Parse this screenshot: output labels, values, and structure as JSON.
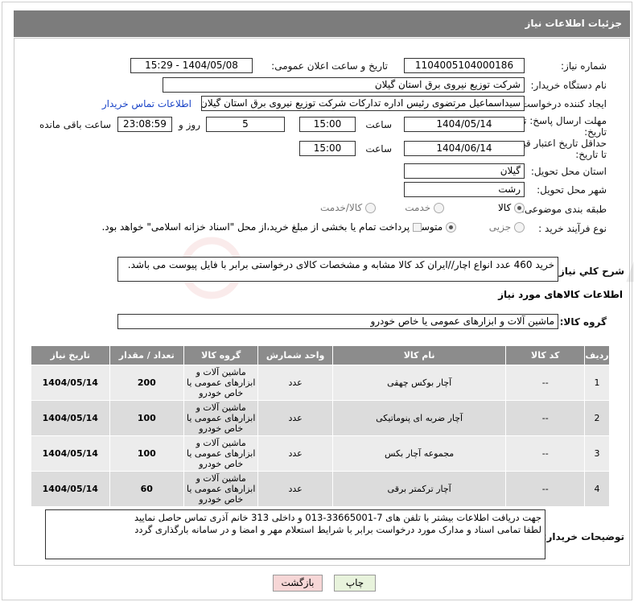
{
  "header": {
    "title": "جزئیات اطلاعات نیاز"
  },
  "fields": {
    "need_number_label": "شماره نیاز:",
    "need_number": "1104005104000186",
    "announce_label": "تاریخ و ساعت اعلان عمومی:",
    "announce_value": "1404/05/08 - 15:29",
    "buyer_label": "نام دستگاه خریدار:",
    "buyer_value": "شرکت توزیع نیروی برق استان گیلان",
    "creator_label": "ایجاد کننده درخواست:",
    "creator_value": "سیداسماعیل مرتضوی رئیس اداره تدارکات شرکت توزیع نیروی برق استان گیلان",
    "contact_link": "اطلاعات تماس خریدار",
    "deadline_label_1": "مهلت ارسال پاسخ: تا",
    "deadline_label_2": "تاریخ:",
    "deadline_date": "1404/05/14",
    "time_label": "ساعت",
    "deadline_time": "15:00",
    "days_value": "5",
    "days_label": "روز و",
    "remaining_time": "23:08:59",
    "remaining_label": "ساعت باقی مانده",
    "price_label_1": "حداقل تاریخ اعتبار قیمت:",
    "price_label_2": "تا تاریخ:",
    "price_date": "1404/06/14",
    "price_time": "15:00",
    "province_label": "استان محل تحویل:",
    "province_value": "گیلان",
    "city_label": "شهر محل تحویل:",
    "city_value": "رشت",
    "category_label": "طبقه بندی موضوعی:",
    "category_opt_goods": "کالا",
    "category_opt_service": "خدمت",
    "category_opt_goods_service": "کالا/خدمت",
    "process_label": "نوع فرآیند خرید :",
    "process_opt_partial": "جزیی",
    "process_opt_medium": "متوسط",
    "payment_note": "پرداخت تمام یا بخشی از مبلغ خرید،از محل \"اسناد خزانه اسلامی\" خواهد بود."
  },
  "description": {
    "label": "شرح کلي نياز:",
    "value": "خرید 460 عدد انواع اچار//ایران کد کالا مشابه و مشخصات کالای درخواستی برابر با فایل پیوست می باشد."
  },
  "goods_section": {
    "title": "اطلاعات کالاهای مورد نیاز",
    "group_label": "گروه کالا:",
    "group_value": "ماشین آلات و ابزارهای عمومی یا خاص خودرو"
  },
  "table": {
    "headers": [
      "ردیف",
      "کد کالا",
      "نام کالا",
      "واحد شمارش",
      "گروه کالا",
      "تعداد / مقدار",
      "تاریخ نیاز"
    ],
    "rows": [
      {
        "row": "1",
        "code": "--",
        "name": "آچار بوکس چهقی",
        "unit": "عدد",
        "group": "ماشین آلات و ابزارهای عمومی یا خاص خودرو",
        "qty": "200",
        "date": "1404/05/14"
      },
      {
        "row": "2",
        "code": "--",
        "name": "آچار ضربه ای پنوماتیکی",
        "unit": "عدد",
        "group": "ماشین آلات و ابزارهای عمومی یا خاص خودرو",
        "qty": "100",
        "date": "1404/05/14"
      },
      {
        "row": "3",
        "code": "--",
        "name": "مجموعه آچار بکس",
        "unit": "عدد",
        "group": "ماشین آلات و ابزارهای عمومی یا خاص خودرو",
        "qty": "100",
        "date": "1404/05/14"
      },
      {
        "row": "4",
        "code": "--",
        "name": "آچار ترکمتر برقی",
        "unit": "عدد",
        "group": "ماشین آلات و ابزارهای عمومی یا خاص خودرو",
        "qty": "60",
        "date": "1404/05/14"
      }
    ]
  },
  "buyer_notes": {
    "label": "توضیحات خریدار:",
    "value": "جهت دریافت اطلاعات بیشتر با تلفن های 7-33665001-013 و داخلی 313 خانم آذری تماس حاصل نمایید\nلطفا تمامی اسناد و مدارک مورد درخواست برابر با شرایط استعلام مهر و امضا و در سامانه بارگذاری گردد"
  },
  "buttons": {
    "print": "چاپ",
    "back": "بازگشت"
  },
  "watermark": {
    "text": "AriaTender.neT"
  },
  "colors": {
    "titlebar": "#7c7c7c",
    "table_header": "#8c8c8c",
    "back_button": "#f6d6d6",
    "print_button": "#e8f3dc",
    "link": "#1a44c7"
  }
}
